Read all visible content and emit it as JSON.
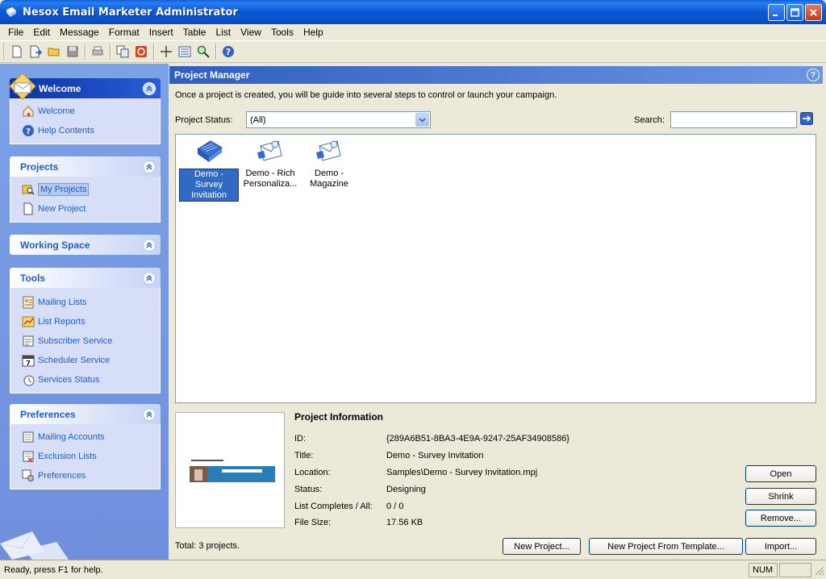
{
  "window": {
    "title": "Nesox Email Marketer Administrator"
  },
  "menu": [
    "File",
    "Edit",
    "Message",
    "Format",
    "Insert",
    "Table",
    "List",
    "View",
    "Tools",
    "Help"
  ],
  "toolbar_icons": [
    "new-icon",
    "open-icon",
    "folder-icon",
    "save-icon",
    "print-icon",
    "copy-icon",
    "stop-icon",
    "move-icon",
    "list-icon",
    "find-icon",
    "help-icon"
  ],
  "sidebar": {
    "welcome": {
      "title": "Welcome",
      "items": [
        "Welcome",
        "Help Contents"
      ]
    },
    "projects": {
      "title": "Projects",
      "items": [
        "My Projects",
        "New Project"
      ]
    },
    "working_space": {
      "title": "Working Space"
    },
    "tools": {
      "title": "Tools",
      "items": [
        "Mailing Lists",
        "List Reports",
        "Subscriber Service",
        "Scheduler Service",
        "Services Status"
      ]
    },
    "preferences": {
      "title": "Preferences",
      "items": [
        "Mailing Accounts",
        "Exclusion Lists",
        "Preferences"
      ]
    }
  },
  "main": {
    "title": "Project Manager",
    "description": "Once a project is created, you will be guide into several steps to control or launch your campaign.",
    "status_label": "Project Status:",
    "status_value": "(All)",
    "search_label": "Search:",
    "search_value": "",
    "projects": [
      {
        "line1": "Demo - Survey",
        "line2": "Invitation",
        "selected": true
      },
      {
        "line1": "Demo - Rich",
        "line2": "Personaliza...",
        "selected": false
      },
      {
        "line1": "Demo -",
        "line2": "Magazine",
        "selected": false
      }
    ],
    "info": {
      "title": "Project Information",
      "labels": {
        "id": "ID:",
        "title": "Title:",
        "location": "Location:",
        "status": "Status:",
        "list": "List Completes / All:",
        "size": "File Size:"
      },
      "values": {
        "id": "{289A6B51-8BA3-4E9A-9247-25AF34908586}",
        "title": "Demo - Survey Invitation",
        "location": "Samples\\Demo - Survey Invitation.mpj",
        "status": "Designing",
        "list": "0 / 0",
        "size": "17.56 KB"
      }
    },
    "buttons": {
      "open": "Open",
      "shrink": "Shrink",
      "remove": "Remove...",
      "new_project": "New Project...",
      "new_from_template": "New Project From Template...",
      "import": "Import..."
    },
    "total": "Total: 3 projects."
  },
  "statusbar": {
    "text": "Ready, press F1 for help.",
    "num": "NUM"
  }
}
